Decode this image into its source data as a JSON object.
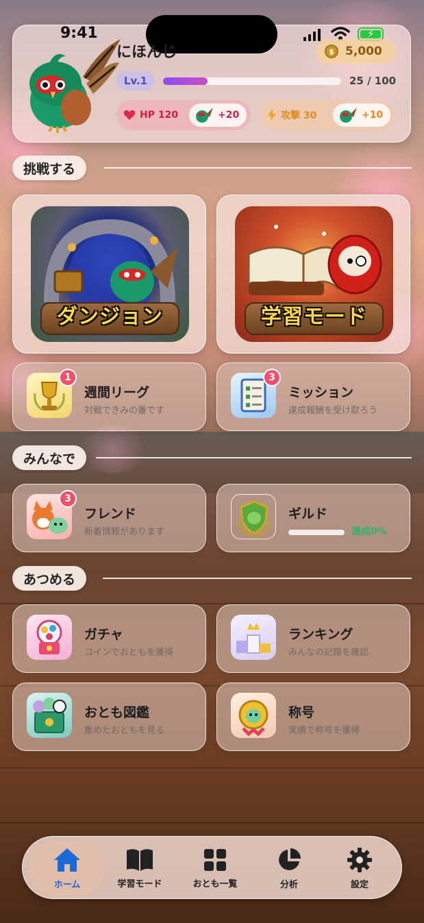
{
  "status_bar": {
    "time": "9:41"
  },
  "profile": {
    "name": "にほんじ",
    "coins": "5,000",
    "coin_symbol": "$",
    "level": "Lv.1",
    "xp_text": "25 / 100",
    "xp_progress": 0.25,
    "hp_label": "HP 120",
    "hp_bonus": "+20",
    "attack_label": "攻撃 30",
    "attack_bonus": "+10"
  },
  "sections": {
    "challenge": "挑戦する",
    "together": "みんなで",
    "collect": "あつめる"
  },
  "big_cards": {
    "dungeon": "ダンジョン",
    "study": "学習モード"
  },
  "cards": {
    "weekly": {
      "title": "週間リーグ",
      "sub": "対戦できみの番です",
      "badge": "1"
    },
    "mission": {
      "title": "ミッション",
      "sub": "達成報酬を受け取ろう",
      "badge": "3"
    },
    "friend": {
      "title": "フレンド",
      "sub": "新着情報があります",
      "badge": "3"
    },
    "guild": {
      "title": "ギルド",
      "progress_text": "達成0%",
      "progress": 0
    },
    "gacha": {
      "title": "ガチャ",
      "sub": "コインでおともを獲得"
    },
    "ranking": {
      "title": "ランキング",
      "sub": "みんなの記録を確認"
    },
    "zukan": {
      "title": "おとも図鑑",
      "sub": "集めたおともを見る"
    },
    "title_card": {
      "title": "称号",
      "sub": "実績で称号を獲得"
    }
  },
  "tabs": {
    "home": "ホーム",
    "study": "学習モード",
    "companions": "おとも一覧",
    "analysis": "分析",
    "settings": "設定"
  },
  "colors": {
    "accent": "#1a6ad8",
    "badge": "#f0506a",
    "hp": "#d02040",
    "attack": "#e38a20",
    "guild_progress": "#2cb56a"
  }
}
